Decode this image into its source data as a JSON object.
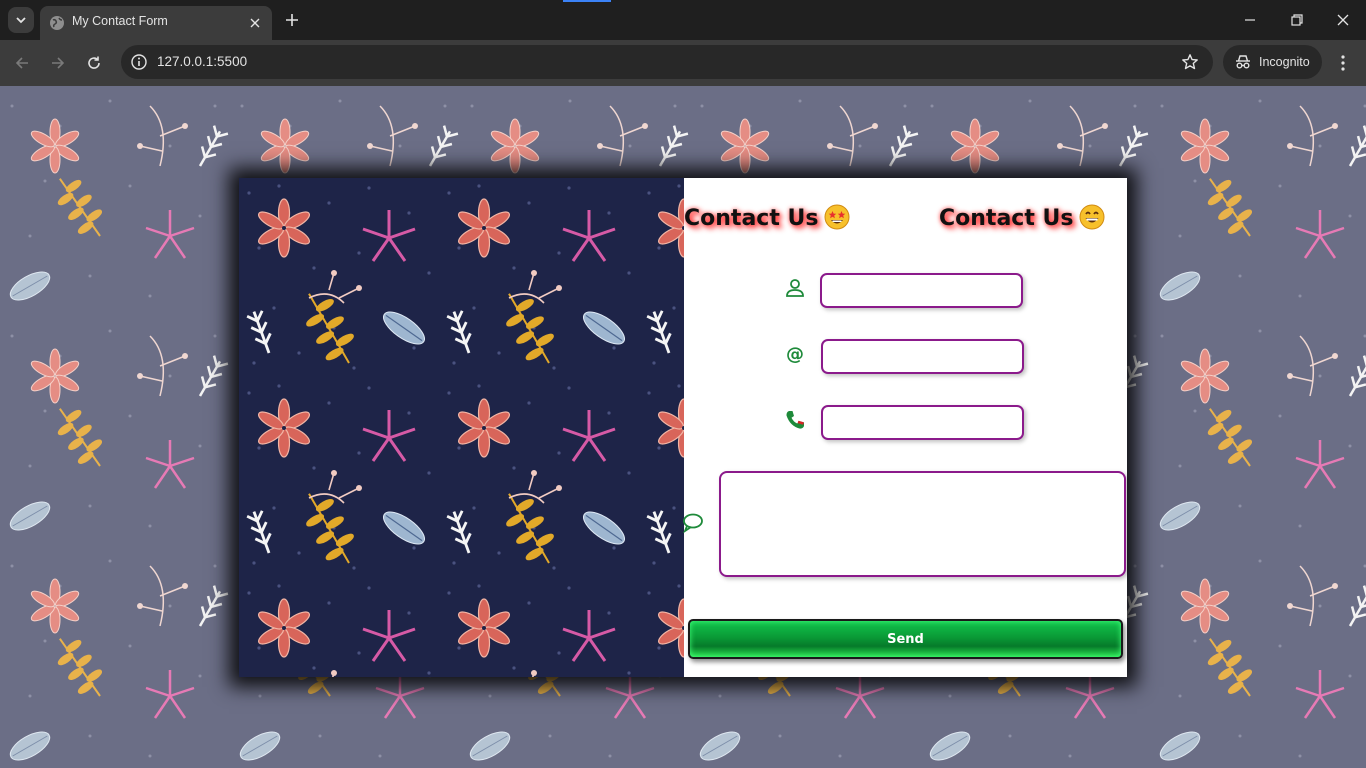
{
  "browser": {
    "tab_title": "My Contact Form",
    "url": "127.0.0.1:5500",
    "incognito_label": "Incognito"
  },
  "page": {
    "heading_left": "Contact Us",
    "heading_right": "Contact Us",
    "heading_left_emoji": "star-struck-emoji",
    "heading_right_emoji": "grinning-emoji",
    "fields": {
      "name": {
        "value": "",
        "icon": "user-icon"
      },
      "email": {
        "value": "",
        "icon": "at-sign-icon"
      },
      "phone": {
        "value": "",
        "icon": "phone-icon"
      },
      "message": {
        "value": "",
        "icon": "speech-bubble-icon"
      }
    },
    "send_label": "Send"
  },
  "colors": {
    "field_border": "#8b1a8b",
    "icon_green": "#1e8a3a",
    "heading_glow": "#ff2424",
    "button_green": "#0a9a36",
    "art_background": "#1e2448",
    "page_background": "#6b6e86"
  }
}
